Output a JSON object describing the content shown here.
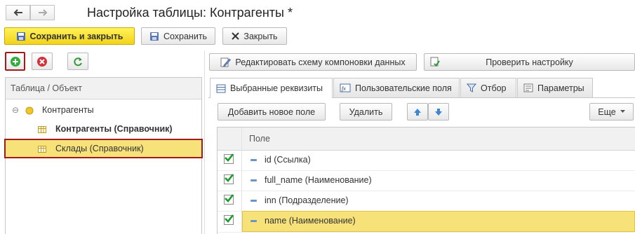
{
  "window": {
    "title": "Настройка таблицы: Контрагенты *"
  },
  "toolbar": {
    "save_close": "Сохранить и закрыть",
    "save": "Сохранить",
    "close": "Закрыть"
  },
  "left": {
    "header": "Таблица / Объект",
    "tree": [
      {
        "label": "Контрагенты"
      },
      {
        "label": "Контрагенты (Справочник)"
      },
      {
        "label": "Склады (Справочник)"
      }
    ]
  },
  "right": {
    "edit_schema": "Редактировать схему компоновки данных",
    "check": "Проверить настройку",
    "tabs": [
      {
        "label": "Выбранные реквизиты"
      },
      {
        "label": "Пользовательские поля"
      },
      {
        "label": "Отбор"
      },
      {
        "label": "Параметры"
      }
    ],
    "add_field": "Добавить новое поле",
    "delete": "Удалить",
    "more": "Еще",
    "grid_header": "Поле",
    "rows": [
      {
        "label": "id (Ссылка)",
        "checked": true
      },
      {
        "label": "full_name (Наименование)",
        "checked": true
      },
      {
        "label": "inn (Подразделение)",
        "checked": true
      },
      {
        "label": "name (Наименование)",
        "checked": true
      }
    ]
  },
  "colors": {
    "accent_yellow": "#f7e27a",
    "selection_border": "#a01c1c",
    "check_green": "#1e9a2e",
    "primary_button": "#f2d21b"
  }
}
